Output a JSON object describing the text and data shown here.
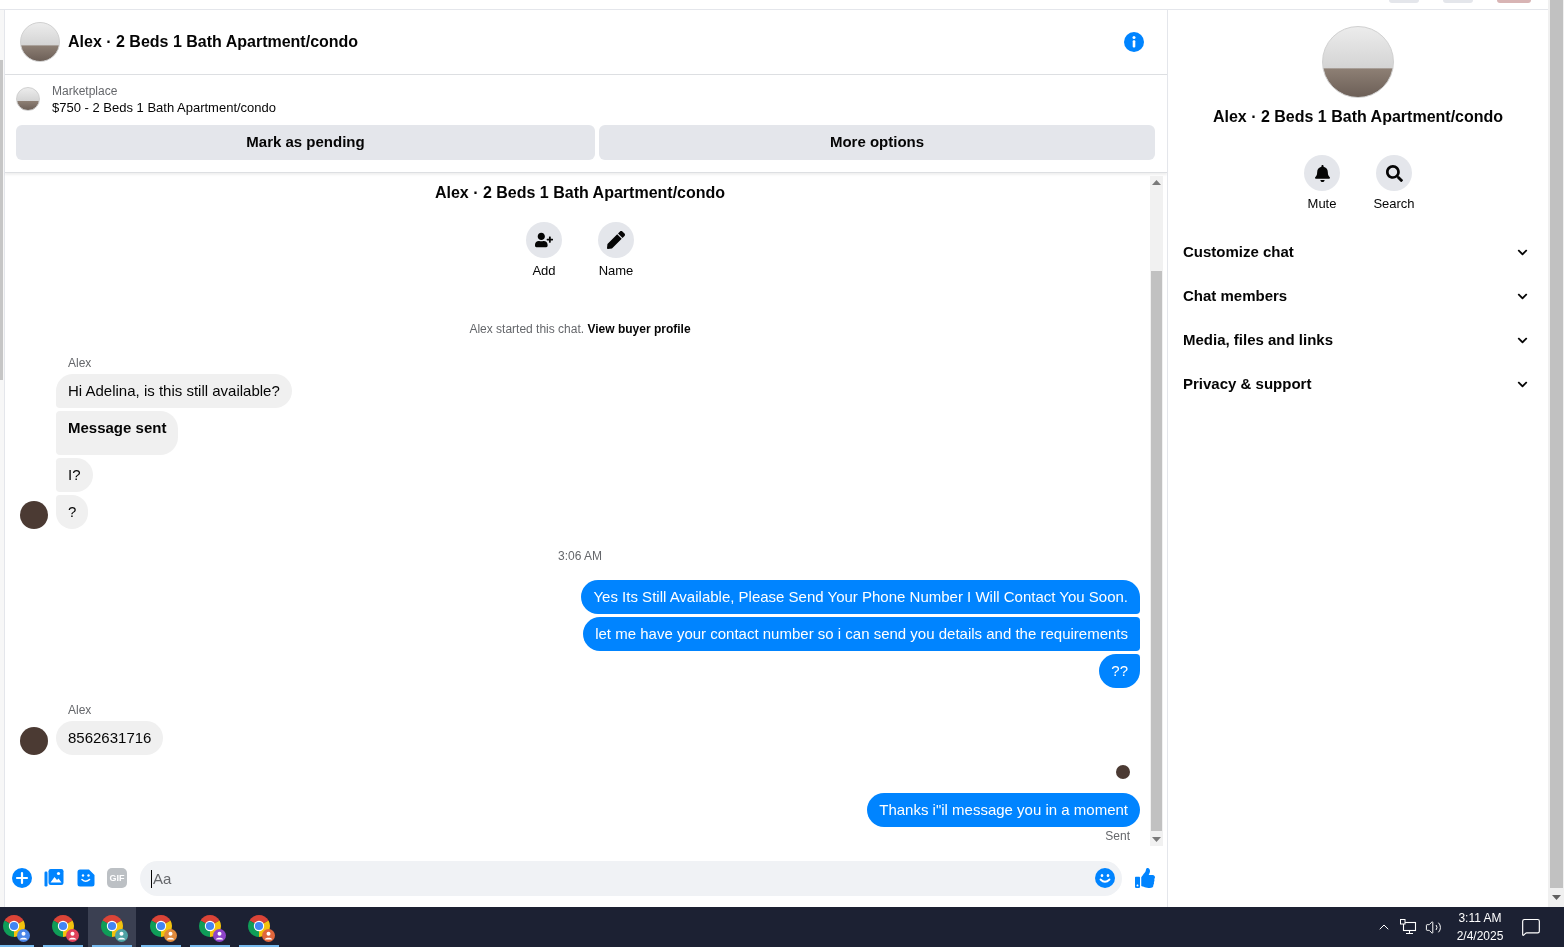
{
  "chat": {
    "header": {
      "title": "Alex · 2 Beds 1 Bath Apartment/condo"
    },
    "listing": {
      "source": "Marketplace",
      "summary": "$750 - 2 Beds 1 Bath Apartment/condo",
      "actions": [
        "Mark as pending",
        "More options"
      ]
    },
    "intro": {
      "title": "Alex · 2 Beds 1 Bath Apartment/condo",
      "actions": [
        "Add",
        "Name"
      ],
      "notice": {
        "text": "Alex started this chat.",
        "link": "View buyer profile"
      }
    },
    "messages": [
      {
        "kind": "sender",
        "text": "Alex"
      },
      {
        "kind": "incoming",
        "text": "Hi Adelina, is this still available?",
        "bold": false
      },
      {
        "kind": "incoming",
        "text": "Message sent",
        "bold": true
      },
      {
        "kind": "incoming",
        "text": "I?",
        "bold": false
      },
      {
        "kind": "incoming",
        "text": "?",
        "bold": false
      },
      {
        "kind": "timestamp",
        "text": "3:06 AM"
      },
      {
        "kind": "outgoing",
        "text": "Yes Its Still Available, Please Send Your Phone Number I Will Contact You Soon."
      },
      {
        "kind": "outgoing",
        "text": "let me have your contact number so i can send you details and the requirements"
      },
      {
        "kind": "outgoing",
        "text": "??"
      },
      {
        "kind": "sender",
        "text": "Alex"
      },
      {
        "kind": "incoming",
        "text": "8562631716",
        "bold": false
      },
      {
        "kind": "seen"
      },
      {
        "kind": "outgoing",
        "text": "Thanks i\"il message you in a moment"
      },
      {
        "kind": "status",
        "text": "Sent"
      }
    ],
    "composer": {
      "gif": "GIF",
      "placeholder": "Aa"
    }
  },
  "details": {
    "title": "Alex · 2 Beds 1 Bath Apartment/condo",
    "actions": [
      "Mute",
      "Search"
    ],
    "sections": [
      {
        "label": "Customize chat",
        "expanded": false
      },
      {
        "label": "Chat members",
        "expanded": false
      },
      {
        "label": "Media, files and links",
        "expanded": false
      },
      {
        "label": "Privacy & support",
        "expanded": false
      }
    ]
  },
  "taskbar": {
    "apps": [
      {
        "color": "#4a86e8",
        "selected": false
      },
      {
        "color": "#e0425c",
        "selected": false
      },
      {
        "color": "#4fa3a5",
        "selected": true
      },
      {
        "color": "#e08a3c",
        "selected": false
      },
      {
        "color": "#8e44c9",
        "selected": false
      },
      {
        "color": "#e0663c",
        "selected": false
      }
    ],
    "clock": {
      "time": "3:11 AM",
      "date": "2/4/2025"
    }
  }
}
